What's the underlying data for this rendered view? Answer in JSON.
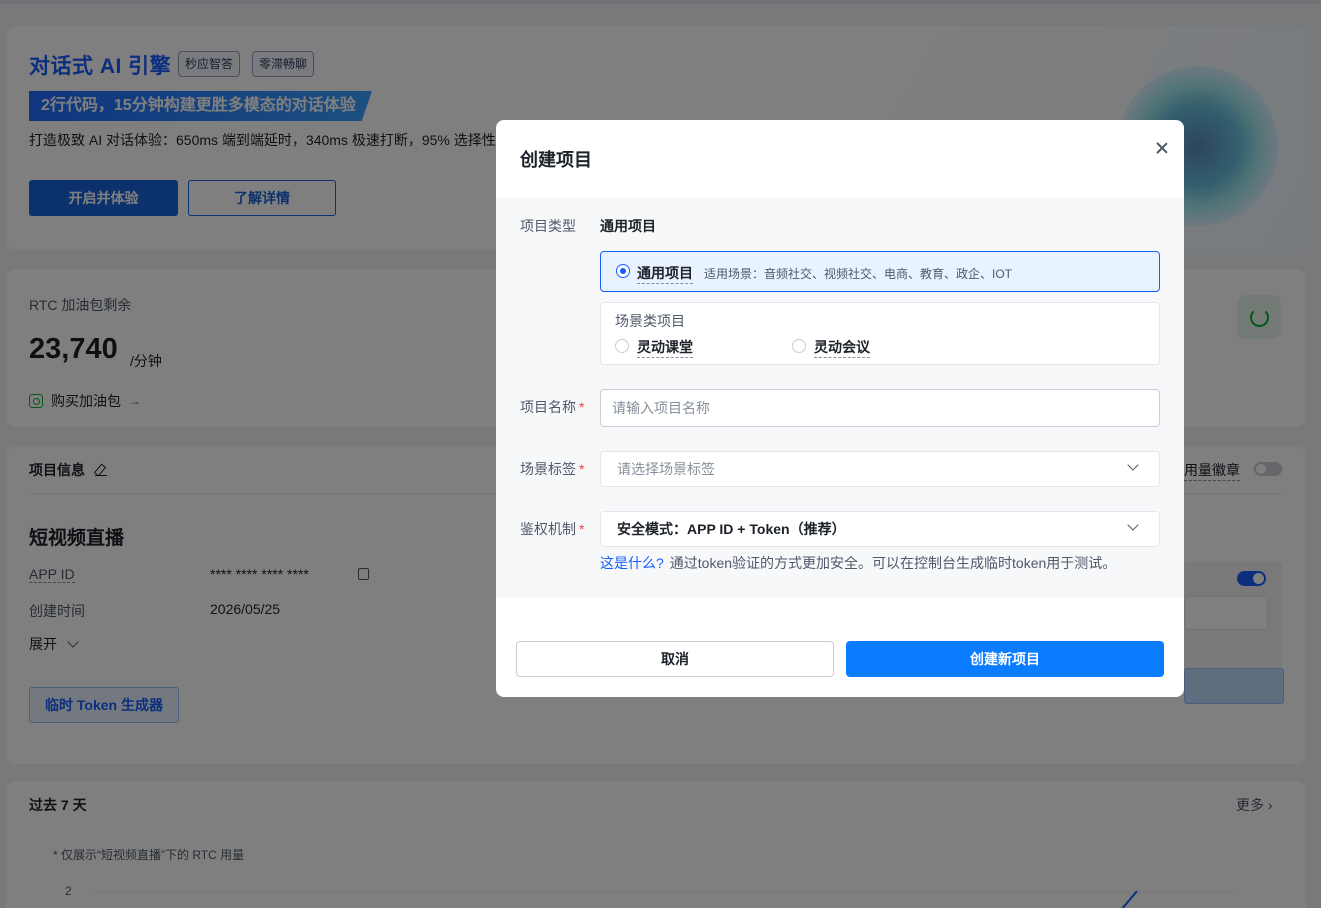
{
  "hero": {
    "title": "对话式 AI 引擎",
    "tags": [
      "秒应智答",
      "零滞畅聊"
    ],
    "ribbon": "2行代码，15分钟构建更胜多模态的对话体验",
    "desc": "打造极致 AI 对话体验：650ms 端到端延时，340ms 极速打断，95% 选择性",
    "btn_start": "开启并体验",
    "btn_learn": "了解详情"
  },
  "rtc": {
    "label": "RTC 加油包剩余",
    "value": "23,740",
    "unit": "/分钟",
    "buy": "购买加油包",
    "buy_arrow": "→"
  },
  "project": {
    "header": "项目信息",
    "right_label": "用量徽章",
    "name": "短视频直播",
    "app_id_label": "APP ID",
    "app_id_value": "**** **** **** ****",
    "created_label": "创建时间",
    "created_value": "2026/05/25",
    "expand": "展开",
    "token_btn": "临时 Token 生成器"
  },
  "usage": {
    "header": "过去 7 天",
    "more": "更多 ›",
    "note": "* 仅展示“短视频直播”下的 RTC 用量",
    "y_tick": "2"
  },
  "modal": {
    "title": "创建项目",
    "type_label": "项目类型",
    "type_value": "通用项目",
    "general_option": "通用项目",
    "general_desc": "适用场景：音频社交、视频社交、电商、教育、政企、IOT",
    "scene_title": "场景类项目",
    "scene_options": [
      "灵动课堂",
      "灵动会议"
    ],
    "name_label": "项目名称",
    "name_placeholder": "请输入项目名称",
    "tag_label": "场景标签",
    "tag_placeholder": "请选择场景标签",
    "auth_label": "鉴权机制",
    "auth_value": "安全模式：APP ID + Token（推荐）",
    "hint_link": "这是什么?",
    "hint_text": "通过token验证的方式更加安全。可以在控制台生成临时token用于测试。",
    "required_mark": "*",
    "cancel": "取消",
    "create": "创建新项目"
  },
  "colors": {
    "primary": "#165dff",
    "create_button": "#0a7cff",
    "required": "#f53f3f"
  }
}
